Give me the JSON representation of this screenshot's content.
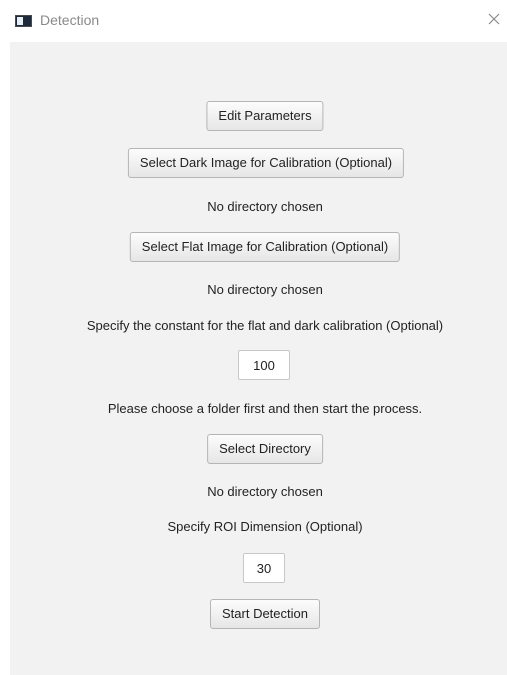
{
  "window": {
    "title": "Detection",
    "icon": "app-window-icon",
    "close_icon": "close-icon"
  },
  "main": {
    "edit_parameters_label": "Edit Parameters",
    "select_dark_label": "Select Dark Image for Calibration (Optional)",
    "dark_status": "No directory chosen",
    "select_flat_label": "Select Flat Image for Calibration (Optional)",
    "flat_status": "No directory chosen",
    "constant_prompt": "Specify the constant for the flat and dark calibration (Optional)",
    "constant_value": "100",
    "folder_prompt": "Please choose a folder first and then start the process.",
    "select_directory_label": "Select Directory",
    "directory_status": "No directory chosen",
    "roi_prompt": "Specify ROI Dimension (Optional)",
    "roi_value": "30",
    "start_detection_label": "Start Detection"
  },
  "colors": {
    "content_background": "#f2f2f2",
    "button_border": "#b5b5b5",
    "title_text": "#8a8a8a"
  }
}
